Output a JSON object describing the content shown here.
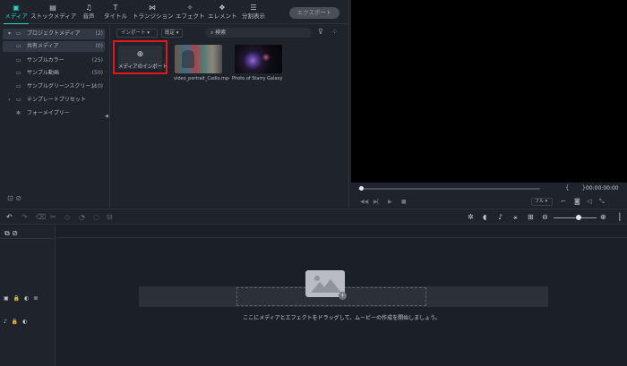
{
  "toolbar": {
    "tabs": [
      {
        "label": "メディア",
        "icon": "folder-icon"
      },
      {
        "label": "ストックメディア",
        "icon": "stock-icon"
      },
      {
        "label": "音声",
        "icon": "music-icon"
      },
      {
        "label": "タイトル",
        "icon": "title-icon"
      },
      {
        "label": "トランジション",
        "icon": "transition-icon"
      },
      {
        "label": "エフェクト",
        "icon": "effects-icon"
      },
      {
        "label": "エレメント",
        "icon": "elements-icon"
      },
      {
        "label": "分割表示",
        "icon": "split-icon"
      }
    ],
    "export_label": "エクスポート",
    "accent": "#2bd6c6"
  },
  "sidebar": {
    "items": [
      {
        "label": "プロジェクトメディア",
        "count": "(2)"
      },
      {
        "label": "共有メディア",
        "count": "(0)"
      },
      {
        "label": "サンプルカラー",
        "count": "(25)"
      },
      {
        "label": "サンプル動画",
        "count": "(50)"
      },
      {
        "label": "サンプルグリーンスクリーン",
        "count": "(10)"
      },
      {
        "label": "テンプレートプリセット",
        "count": ""
      },
      {
        "label": "フォーメイプリー",
        "count": ""
      }
    ]
  },
  "content": {
    "import_label": "インポート",
    "sort_label": "既定",
    "search_placeholder": "検索",
    "import_tile_label": "メディアのインポート",
    "thumbnails": [
      {
        "caption": "video_portrait_Cadio.mp4"
      },
      {
        "caption": "Photo of Starry Galaxy"
      }
    ]
  },
  "preview": {
    "timecode": "00:00:00:00",
    "quality": "フル"
  },
  "timeline": {
    "drop_hint": "ここにメディアとエフェクトをドラッグして、ムービーの作成を開始しましょう。"
  }
}
